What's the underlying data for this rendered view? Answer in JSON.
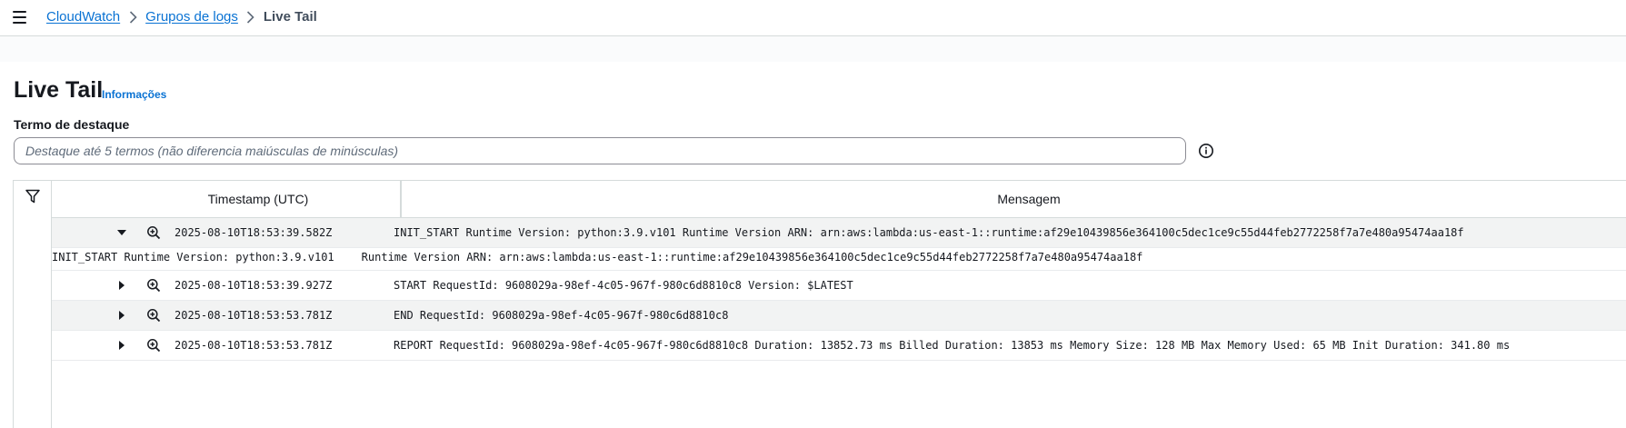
{
  "breadcrumb": {
    "items": [
      {
        "label": "CloudWatch"
      },
      {
        "label": "Grupos de logs"
      }
    ],
    "current": "Live Tail"
  },
  "page": {
    "title": "Live Tail",
    "info_link": "Informações"
  },
  "highlight": {
    "label": "Termo de destaque",
    "placeholder": "Destaque até 5 termos (não diferencia maiúsculas de minúsculas)",
    "value": ""
  },
  "table": {
    "columns": [
      "Timestamp (UTC)",
      "Mensagem"
    ],
    "rows": [
      {
        "expanded": true,
        "timestamp": "2025-08-10T18:53:39.582Z",
        "message": "INIT_START Runtime Version: python:3.9.v101 Runtime Version ARN: arn:aws:lambda:us-east-1::runtime:af29e10439856e364100c5dec1ce9c55d44feb2772258f7a7e480a95474aa18f",
        "detail": {
          "part1": "INIT_START Runtime Version: python:3.9.v101",
          "part2": "Runtime Version ARN: arn:aws:lambda:us-east-1::runtime:af29e10439856e364100c5dec1ce9c55d44feb2772258f7a7e480a95474aa18f"
        }
      },
      {
        "expanded": false,
        "timestamp": "2025-08-10T18:53:39.927Z",
        "message": "START RequestId: 9608029a-98ef-4c05-967f-980c6d8810c8 Version: $LATEST"
      },
      {
        "expanded": false,
        "timestamp": "2025-08-10T18:53:53.781Z",
        "message": "END RequestId: 9608029a-98ef-4c05-967f-980c6d8810c8"
      },
      {
        "expanded": false,
        "timestamp": "2025-08-10T18:53:53.781Z",
        "message": "REPORT RequestId: 9608029a-98ef-4c05-967f-980c6d8810c8 Duration: 13852.73 ms Billed Duration: 13853 ms Memory Size: 128 MB Max Memory Used: 65 MB Init Duration: 341.80 ms"
      }
    ]
  },
  "icons": {
    "menu": "hamburger-icon",
    "breadcrumb_separator": "chevron-right-icon",
    "info": "info-circle-icon",
    "filter": "filter-icon",
    "expand": "caret-right-icon",
    "collapse": "caret-down-icon",
    "zoom": "zoom-in-icon"
  },
  "colors": {
    "link": "#0972d3",
    "text": "#16191f",
    "border": "#d5dbdb",
    "row_alt": "#f2f3f3"
  }
}
